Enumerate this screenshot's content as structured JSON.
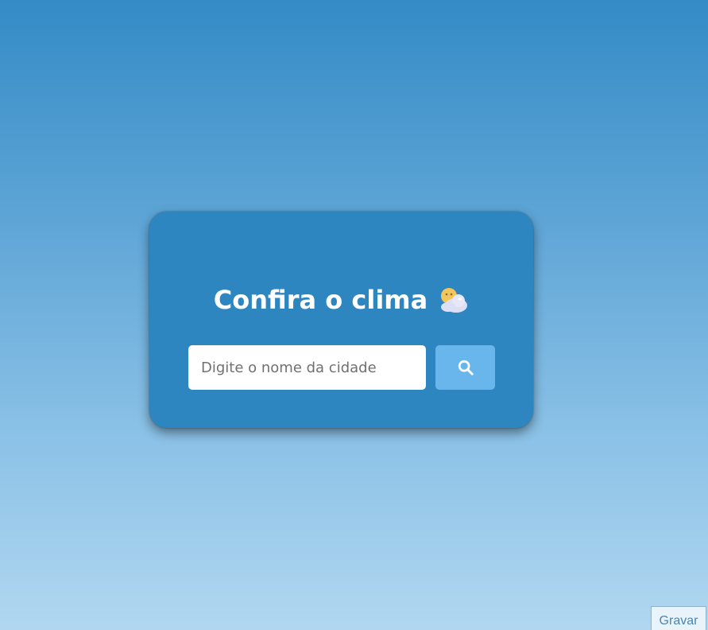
{
  "card": {
    "title": "Confira o clima",
    "title_icon": "sun-behind-cloud-icon"
  },
  "search": {
    "placeholder": "Digite o nome da cidade",
    "value": "",
    "button_icon": "search-icon"
  },
  "recorder": {
    "label": "Gravar"
  },
  "colors": {
    "card_background": "#2e86c1",
    "search_button": "#69b6ec",
    "title_text": "#ffffff"
  }
}
